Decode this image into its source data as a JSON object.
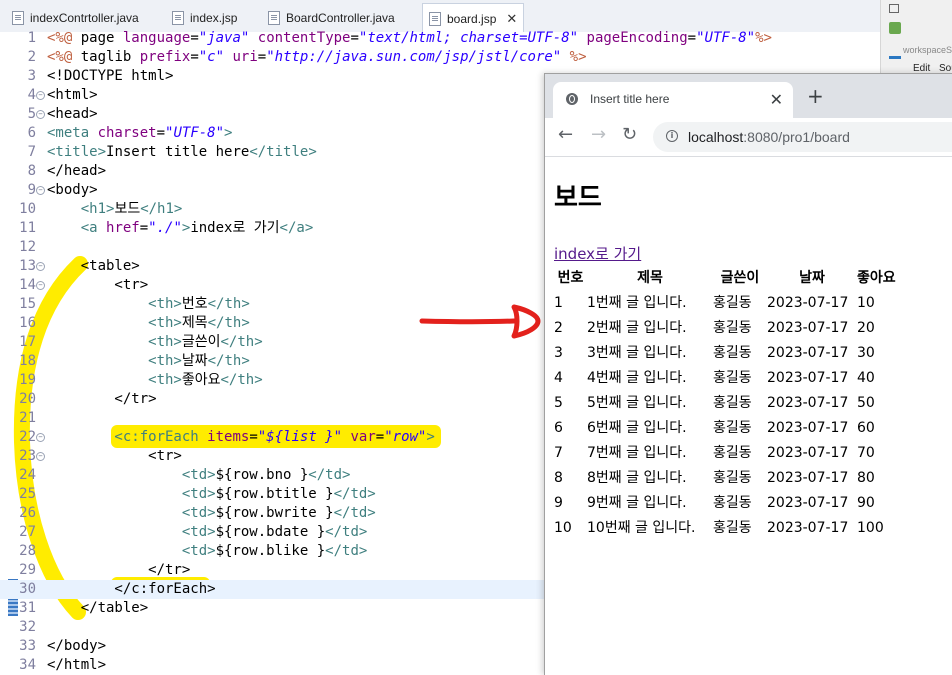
{
  "editor": {
    "tabs": [
      {
        "label": "indexContrtoller.java"
      },
      {
        "label": "index.jsp"
      },
      {
        "label": "BoardController.java"
      },
      {
        "label": "board.jsp",
        "close": "✕"
      }
    ],
    "side_toolbar": {
      "workspace_label": "workspaceSp",
      "edit_label": "Edit",
      "source_label": "Sou"
    },
    "lines": [
      {
        "n": "1",
        "fold": false
      },
      {
        "n": "2",
        "fold": false
      },
      {
        "n": "3",
        "fold": false
      },
      {
        "n": "4",
        "fold": true
      },
      {
        "n": "5",
        "fold": true
      },
      {
        "n": "6",
        "fold": false
      },
      {
        "n": "7",
        "fold": false
      },
      {
        "n": "8",
        "fold": false
      },
      {
        "n": "9",
        "fold": true
      },
      {
        "n": "10",
        "fold": false
      },
      {
        "n": "11",
        "fold": false
      },
      {
        "n": "12",
        "fold": false
      },
      {
        "n": "13",
        "fold": true
      },
      {
        "n": "14",
        "fold": true
      },
      {
        "n": "15",
        "fold": false
      },
      {
        "n": "16",
        "fold": false
      },
      {
        "n": "17",
        "fold": false
      },
      {
        "n": "18",
        "fold": false
      },
      {
        "n": "19",
        "fold": false
      },
      {
        "n": "20",
        "fold": false
      },
      {
        "n": "21",
        "fold": false
      },
      {
        "n": "22",
        "fold": true
      },
      {
        "n": "23",
        "fold": true
      },
      {
        "n": "24",
        "fold": false
      },
      {
        "n": "25",
        "fold": false
      },
      {
        "n": "26",
        "fold": false
      },
      {
        "n": "27",
        "fold": false
      },
      {
        "n": "28",
        "fold": false
      },
      {
        "n": "29",
        "fold": false
      },
      {
        "n": "30",
        "fold": false
      },
      {
        "n": "31",
        "fold": false
      },
      {
        "n": "32",
        "fold": false
      },
      {
        "n": "33",
        "fold": false
      },
      {
        "n": "34",
        "fold": false
      }
    ],
    "code": {
      "l1": [
        "<%@",
        " page ",
        "language",
        "=",
        "\"java\"",
        " ",
        "contentType",
        "=",
        "\"text/html; charset=UTF-8\"",
        " ",
        "pageEncoding",
        "=",
        "\"UTF-8\"",
        "%>"
      ],
      "l2": [
        "<%@",
        " taglib ",
        "prefix",
        "=",
        "\"c\"",
        " ",
        "uri",
        "=",
        "\"http://java.sun.com/jsp/jstl/core\"",
        " ",
        "%>"
      ],
      "l3": "<!DOCTYPE html>",
      "l4": "<html>",
      "l5": "<head>",
      "l6": [
        "<meta ",
        "charset",
        "=",
        "\"UTF-8\"",
        ">"
      ],
      "l7": [
        "<title>",
        "Insert title here",
        "</title>"
      ],
      "l8": "</head>",
      "l9": "<body>",
      "l10": [
        "    <h1>",
        "보드",
        "</h1>"
      ],
      "l11": [
        "    <a ",
        "href",
        "=",
        "\"./\"",
        ">",
        "index로 가기",
        "</a>"
      ],
      "l13": "    <table>",
      "l14": "        <tr>",
      "l15": [
        "            <th>",
        "번호",
        "</th>"
      ],
      "l16": [
        "            <th>",
        "제목",
        "</th>"
      ],
      "l17": [
        "            <th>",
        "글쓴이",
        "</th>"
      ],
      "l18": [
        "            <th>",
        "날짜",
        "</th>"
      ],
      "l19": [
        "            <th>",
        "좋아요",
        "</th>"
      ],
      "l20": "        </tr>",
      "l22": [
        "        <c:forEach ",
        "items",
        "=",
        "\"${list }\"",
        " ",
        "var",
        "=",
        "\"row\"",
        ">"
      ],
      "l23": "            <tr>",
      "l24": [
        "                <td>",
        "${row.bno }",
        "</td>"
      ],
      "l25": [
        "                <td>",
        "${row.btitle }",
        "</td>"
      ],
      "l26": [
        "                <td>",
        "${row.bwrite }",
        "</td>"
      ],
      "l27": [
        "                <td>",
        "${row.bdate }",
        "</td>"
      ],
      "l28": [
        "                <td>",
        "${row.blike }",
        "</td>"
      ],
      "l29": "            </tr>",
      "l30": "        </c:forEach>",
      "l31": "    </table>",
      "l33": "</body>",
      "l34": "</html>"
    }
  },
  "browser": {
    "tab_title": "Insert title here",
    "tab_close": "✕",
    "new_tab": "+",
    "back": "←",
    "forward": "→",
    "reload": "↻",
    "info_icon": "i",
    "url_host": "localhost",
    "url_rest": ":8080/pro1/board",
    "page": {
      "heading": "보드",
      "link": "index로 가기",
      "headers": [
        "번호",
        "제목",
        "글쓴이",
        "날짜",
        "좋아요"
      ],
      "rows": [
        [
          "1",
          "1번째 글 입니다.",
          "홍길동",
          "2023-07-17",
          "10"
        ],
        [
          "2",
          "2번째 글 입니다.",
          "홍길동",
          "2023-07-17",
          "20"
        ],
        [
          "3",
          "3번째 글 입니다.",
          "홍길동",
          "2023-07-17",
          "30"
        ],
        [
          "4",
          "4번째 글 입니다.",
          "홍길동",
          "2023-07-17",
          "40"
        ],
        [
          "5",
          "5번째 글 입니다.",
          "홍길동",
          "2023-07-17",
          "50"
        ],
        [
          "6",
          "6번째 글 입니다.",
          "홍길동",
          "2023-07-17",
          "60"
        ],
        [
          "7",
          "7번째 글 입니다.",
          "홍길동",
          "2023-07-17",
          "70"
        ],
        [
          "8",
          "8번째 글 입니다.",
          "홍길동",
          "2023-07-17",
          "80"
        ],
        [
          "9",
          "9번째 글 입니다.",
          "홍길동",
          "2023-07-17",
          "90"
        ],
        [
          "10",
          "10번째 글 입니다.",
          "홍길동",
          "2023-07-17",
          "100"
        ]
      ]
    }
  },
  "colors": {
    "highlighter": "#ffec00",
    "arrow": "#e3211c",
    "tag": "#3f7f7f",
    "attr": "#7f007f",
    "string": "#2a00ff",
    "jsp": "#bf5f3f"
  }
}
